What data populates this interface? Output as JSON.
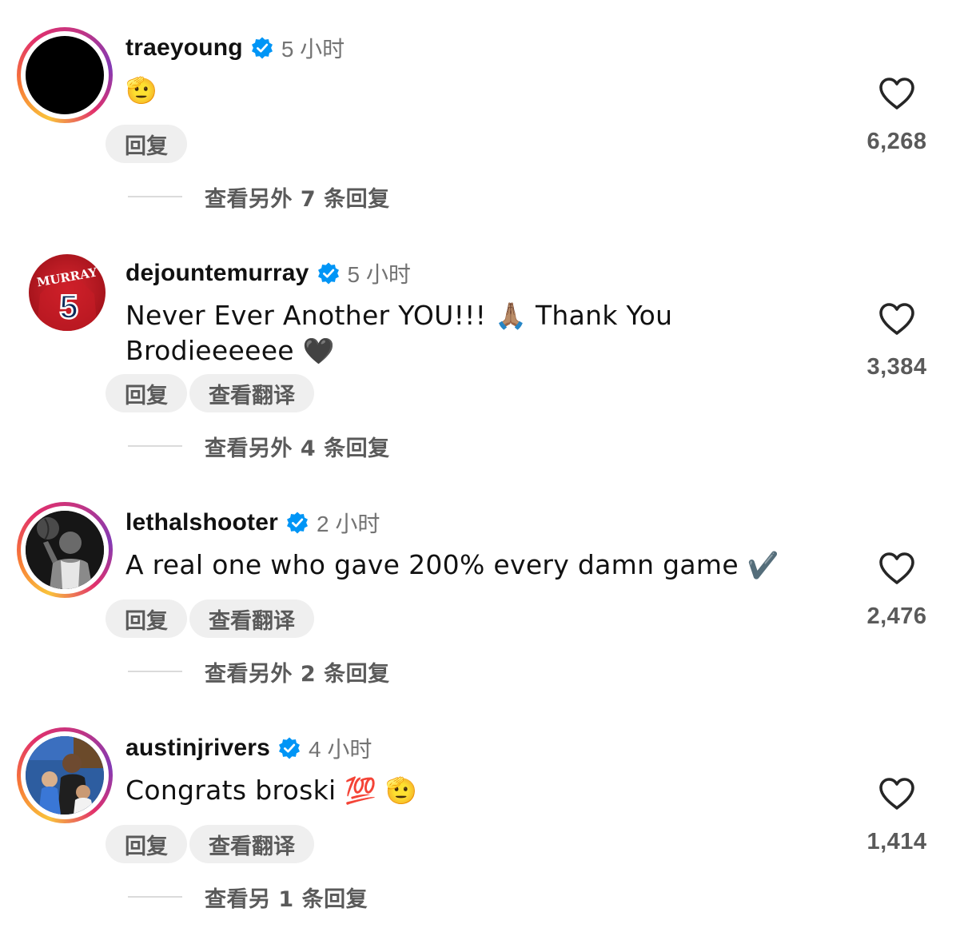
{
  "comments": [
    {
      "username": "traeyoung",
      "time": "5 小时",
      "text": "",
      "emoji": "🫡",
      "reply_label": "回复",
      "more_replies": "查看另外 7 条回复",
      "likes": "6,268",
      "avatar_style": "black"
    },
    {
      "username": "dejountemurray",
      "time": "5 小时",
      "text_line1": "Never Ever Another YOU!!!",
      "emoji1": "🙏🏽",
      "text_line1b": "Thank You",
      "text_line2": "Brodieeeeee",
      "emoji2": "🖤",
      "reply_label": "回复",
      "translate_label": "查看翻译",
      "more_replies": "查看另外 4 条回复",
      "likes": "3,384",
      "jersey_name": "MURRAY",
      "jersey_number": "5"
    },
    {
      "username": "lethalshooter",
      "time": "2 小时",
      "text": "A real one who gave 200% every damn game",
      "emoji": "✔️",
      "reply_label": "回复",
      "translate_label": "查看翻译",
      "more_replies": "查看另外 2 条回复",
      "likes": "2,476"
    },
    {
      "username": "austinjrivers",
      "time": "4 小时",
      "text": "Congrats broski",
      "emoji1": "💯",
      "emoji2": "🫡",
      "reply_label": "回复",
      "translate_label": "查看翻译",
      "more_replies": "查看另 1 条回复",
      "likes": "1,414"
    }
  ],
  "colors": {
    "verified": "#0095f6",
    "secondary_text": "#737373",
    "pill_bg": "#efefef",
    "story_ring": [
      "#f9c33b",
      "#e1306c",
      "#833ab4"
    ]
  },
  "icons": {
    "verified": "verified-badge-icon",
    "like": "heart-outline-icon"
  }
}
